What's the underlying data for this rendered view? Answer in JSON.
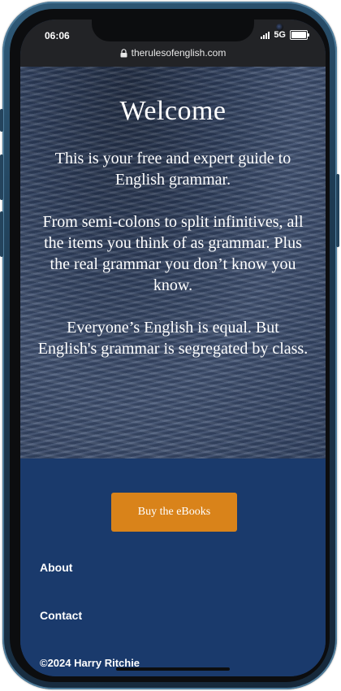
{
  "status_bar": {
    "time": "06:06",
    "network": "5G",
    "signal_icon": "signal-bars-icon",
    "battery_icon": "battery-icon"
  },
  "browser": {
    "url": "therulesofenglish.com",
    "lock_icon": "lock-icon"
  },
  "hero": {
    "title": "Welcome",
    "paragraphs": [
      "This is your free and expert guide to English grammar.",
      "From semi-colons to split infinitives, all the items you think of as grammar. Plus the real grammar you don’t know you know.",
      "Everyone’s English is equal. But English's grammar is segregated by class."
    ]
  },
  "footer": {
    "buy_button_label": "Buy the eBooks",
    "links": [
      "About",
      "Contact"
    ],
    "copyright": "©2024 Harry Ritchie"
  },
  "colors": {
    "footer_bg": "#1a3a6c",
    "button_bg": "#d9831a",
    "status_bar_bg": "#222326"
  }
}
